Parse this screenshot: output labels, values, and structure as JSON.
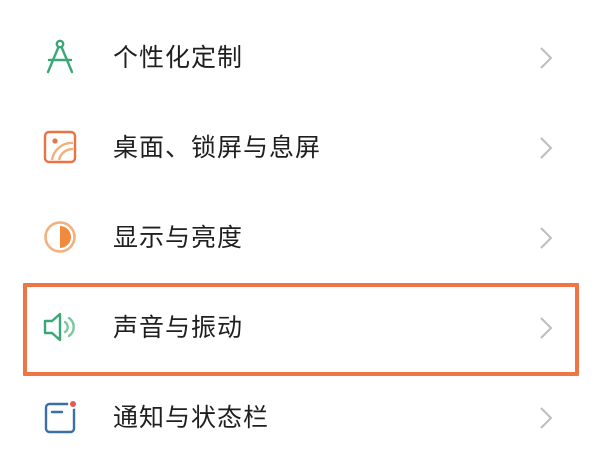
{
  "settings": {
    "items": [
      {
        "label": "个性化定制",
        "icon": "compass-personalize-icon",
        "color": "#3aa776"
      },
      {
        "label": "桌面、锁屏与息屏",
        "icon": "wallpaper-icon",
        "color": "#ea7243"
      },
      {
        "label": "显示与亮度",
        "icon": "brightness-icon",
        "color": "#f08a3c"
      },
      {
        "label": "声音与振动",
        "icon": "speaker-icon",
        "color": "#3aa776"
      },
      {
        "label": "通知与状态栏",
        "icon": "notification-icon",
        "color": "#3b6fa8"
      }
    ],
    "highlighted_item": "声音与振动",
    "highlight_color": "#f07545",
    "chevron_color": "#bdbdbd"
  }
}
